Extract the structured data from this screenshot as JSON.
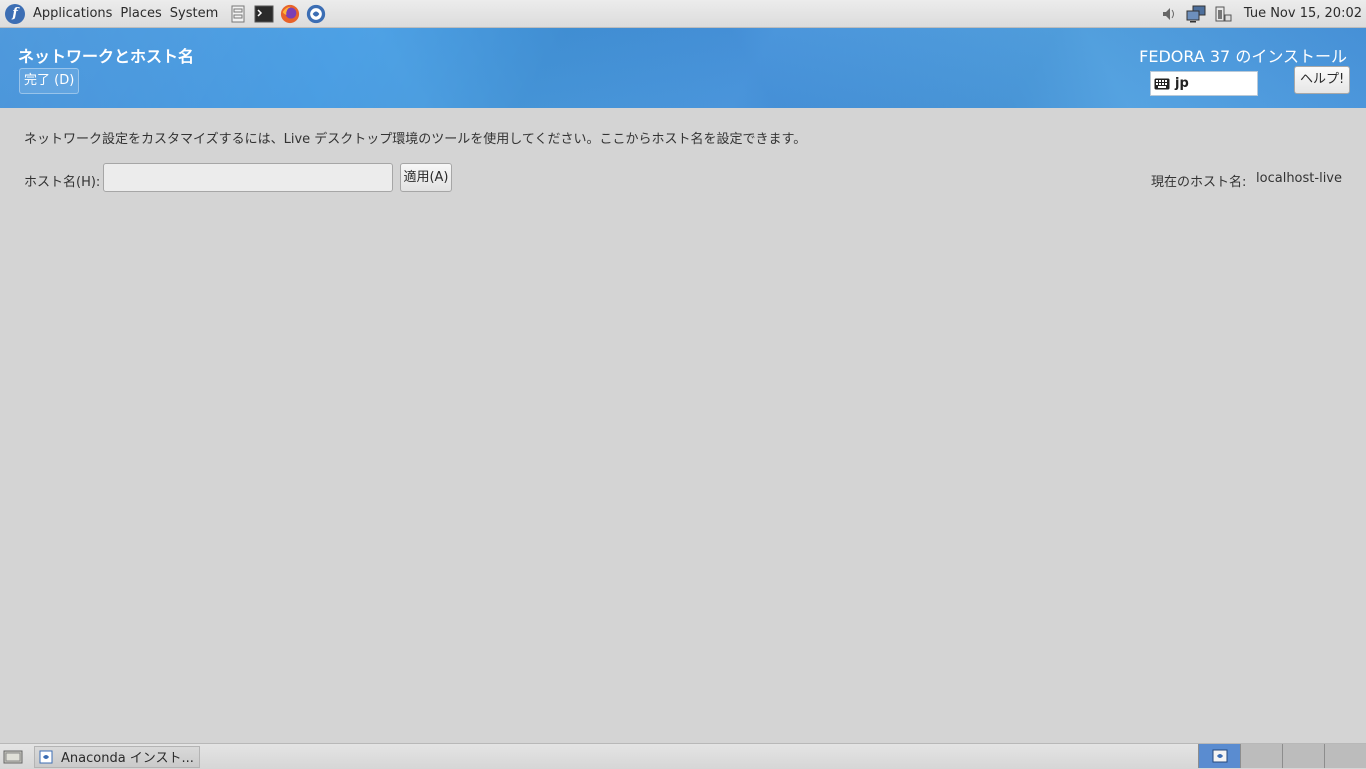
{
  "topbar": {
    "menus": [
      "Applications",
      "Places",
      "System"
    ],
    "launchers": [
      "files-icon",
      "terminal-icon",
      "firefox-icon",
      "anaconda-icon"
    ],
    "clock": "Tue Nov 15, 20:02"
  },
  "header": {
    "spoke_title": "ネットワークとホスト名",
    "done_label": "完了 (D)",
    "product_title": "FEDORA 37 のインストール",
    "keyboard_layout": "jp",
    "help_label": "ヘルプ!"
  },
  "content": {
    "info_text": "ネットワーク設定をカスタマイズするには、Live デスクトップ環境のツールを使用してください。ここからホスト名を設定できます。",
    "hostname_label": "ホスト名(H):",
    "hostname_value": "",
    "apply_label": "適用(A)",
    "current_host_label": "現在のホスト名:",
    "current_host_value": "localhost-live"
  },
  "taskbar": {
    "task_label": "Anaconda インスト...",
    "workspaces": 4,
    "active_workspace": 1
  },
  "colors": {
    "header_blue": "#4a9be2",
    "background": "#d4d4d4",
    "accent": "#3c6eb4"
  }
}
